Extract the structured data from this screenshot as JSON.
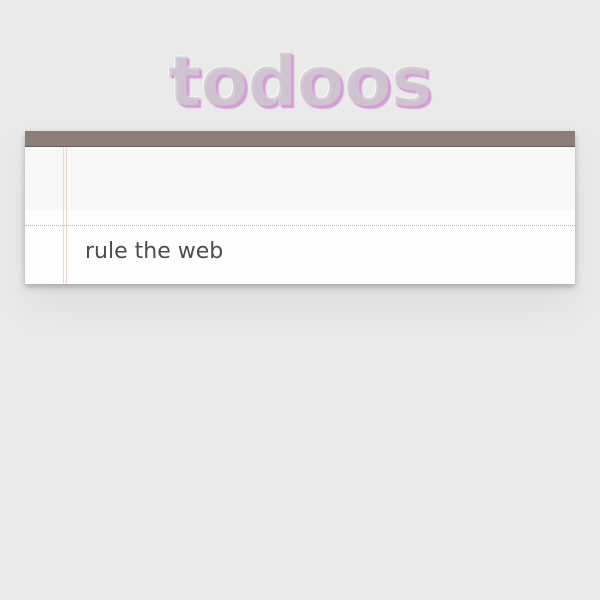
{
  "app": {
    "title": "todoos"
  },
  "new_todo": {
    "value": "",
    "placeholder": ""
  },
  "todos": [
    {
      "label": "rule the web",
      "completed": false
    }
  ],
  "colors": {
    "background": "#eaeaea",
    "header_bar": "#8d7d77",
    "title_text": "#b4b4b4",
    "item_text": "#4d4d4d",
    "margin_line": "#f1d6cf"
  }
}
